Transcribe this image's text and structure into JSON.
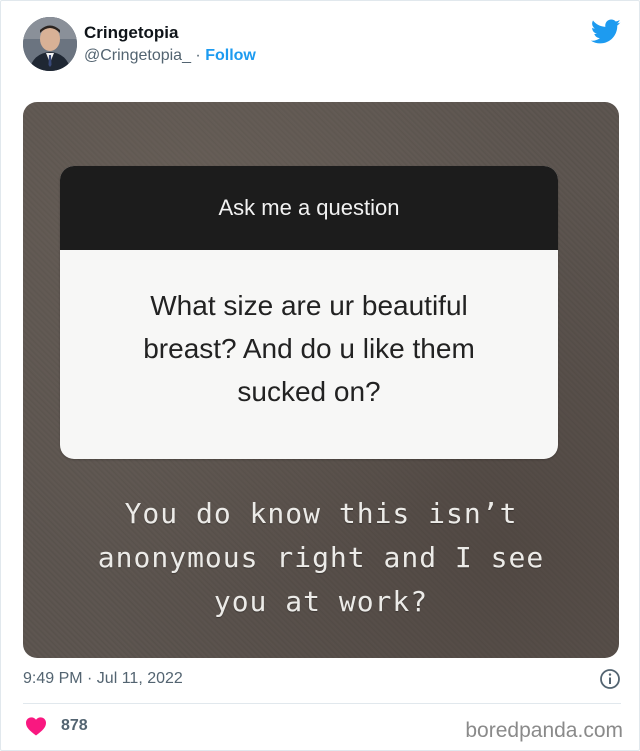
{
  "author": {
    "name": "Cringetopia",
    "handle": "@Cringetopia_",
    "separator": "·",
    "follow_label": "Follow"
  },
  "icons": {
    "avatar": "avatar",
    "brand": "twitter-bird-icon",
    "info": "info-icon",
    "like": "heart-icon"
  },
  "media": {
    "question_header": "Ask me a question",
    "question_text": [
      "What size are ur beautiful",
      "breast? And do u like them",
      "sucked on?"
    ],
    "reply_text": [
      "You do know this isn’t",
      "anonymous right and I see",
      "you at work?"
    ]
  },
  "meta": {
    "timestamp": "9:49 PM · Jul 11, 2022",
    "likes": "878"
  },
  "watermark": "boredpanda.com",
  "colors": {
    "twitter_blue": "#1d9bf0",
    "like_pink": "#f91880",
    "text_secondary": "#536471"
  }
}
